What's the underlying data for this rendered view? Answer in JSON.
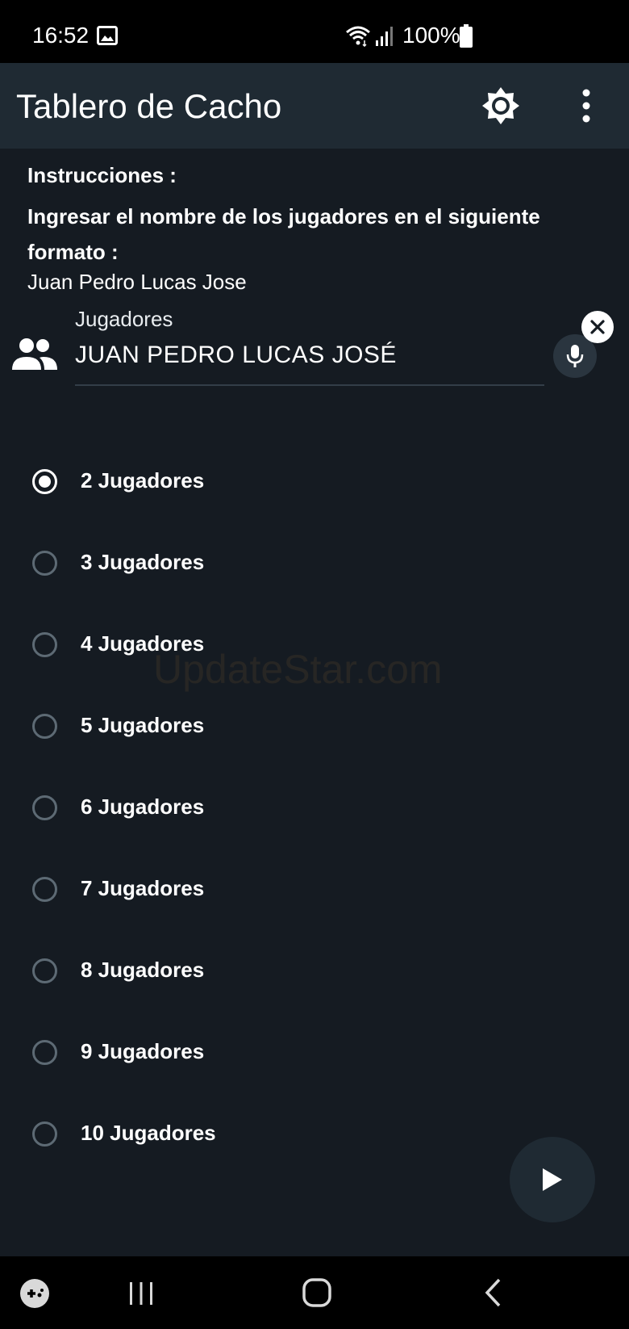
{
  "status_bar": {
    "time": "16:52",
    "battery": "100%",
    "icons": [
      "image-icon",
      "wifi-icon",
      "signal-icon",
      "battery-icon"
    ]
  },
  "app_bar": {
    "title": "Tablero de Cacho",
    "icons": [
      "brightness-icon",
      "more-vert-icon"
    ]
  },
  "instructions": {
    "title": "Instrucciones :",
    "body": "Ingresar el nombre de los jugadores en el siguiente formato :",
    "example": "Juan Pedro Lucas Jose"
  },
  "players_field": {
    "label": "Jugadores",
    "value": "JUAN PEDRO LUCAS JOSÉ",
    "icons": [
      "people-icon",
      "mic-icon",
      "clear-icon"
    ]
  },
  "player_options": {
    "selected_index": 0,
    "items": [
      {
        "label": "2 Jugadores"
      },
      {
        "label": "3 Jugadores"
      },
      {
        "label": "4 Jugadores"
      },
      {
        "label": "5 Jugadores"
      },
      {
        "label": "6 Jugadores"
      },
      {
        "label": "7 Jugadores"
      },
      {
        "label": "8 Jugadores"
      },
      {
        "label": "9 Jugadores"
      },
      {
        "label": "10 Jugadores"
      }
    ]
  },
  "watermark": "UpdateStar.com",
  "fab": {
    "icon": "play-icon"
  },
  "nav_bar": {
    "icons": [
      "game-launcher-icon",
      "recents-icon",
      "home-icon",
      "back-icon"
    ]
  },
  "colors": {
    "background": "#151b22",
    "app_bar": "#1f2a33",
    "system_bars": "#000000",
    "text": "#ffffff",
    "radio_unselected": "#5d6a74"
  }
}
